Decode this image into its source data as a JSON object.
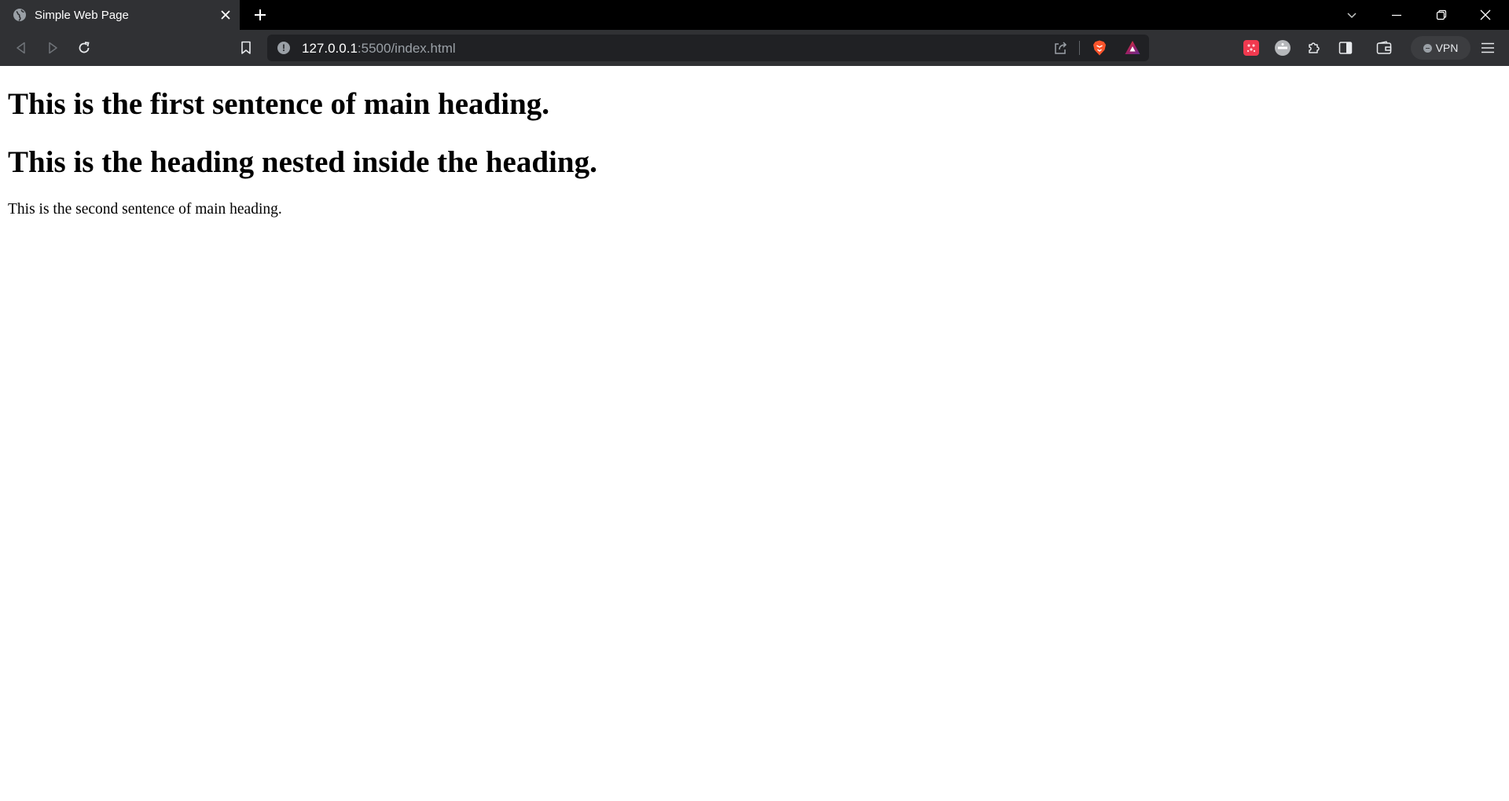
{
  "tab": {
    "title": "Simple Web Page",
    "favicon": "globe-icon"
  },
  "toolbar": {
    "url_host": "127.0.0.1",
    "url_path": ":5500/index.html",
    "vpn_label": "VPN"
  },
  "page": {
    "heading_1": "This is the first sentence of main heading.",
    "heading_2": "This is the heading nested inside the heading.",
    "paragraph": "This is the second sentence of main heading."
  },
  "colors": {
    "tabstrip_bg": "#000000",
    "toolbar_bg": "#303134",
    "omnibox_bg": "#202124",
    "brave_orange": "#fb542b",
    "page_bg": "#ffffff"
  }
}
